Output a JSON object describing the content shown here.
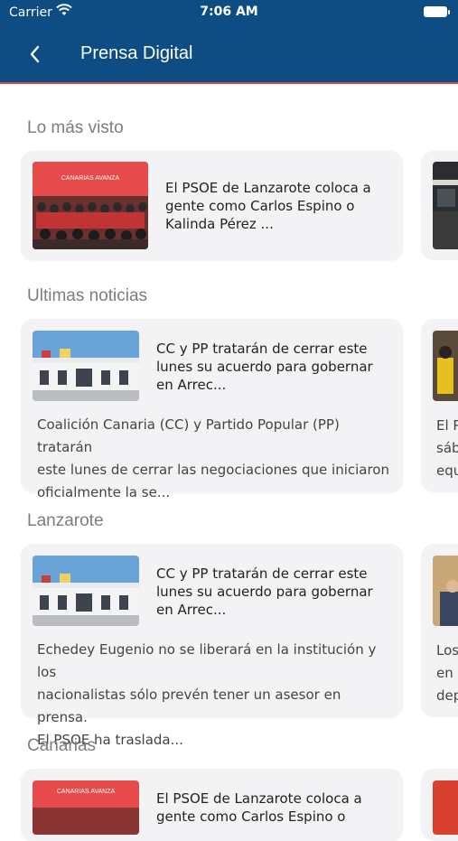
{
  "status_bar": {
    "carrier": "Carrier",
    "time": "7:06 AM"
  },
  "nav": {
    "title": "Prensa Digital"
  },
  "sections": {
    "mas_visto": {
      "title": "Lo más visto",
      "card": {
        "headline": "El PSOE de Lanzarote coloca a\ngente como Carlos Espino o\nKalinda Pérez ...",
        "thumb_text": "CANARIAS AVANZA"
      }
    },
    "ultimas": {
      "title": "Ultimas noticias",
      "card": {
        "headline": "CC y PP tratarán de cerrar este\nlunes su acuerdo para gobernar\nen Arrec...",
        "summary": "Coalición Canaria (CC) y Partido Popular (PP) tratarán\neste lunes de cerrar las negociaciones que iniciaron\noficialmente la se..."
      },
      "peek_text": "El P\nsáb\nequ"
    },
    "lanzarote": {
      "title": "Lanzarote",
      "card": {
        "headline": "CC y PP tratarán de cerrar este\nlunes su acuerdo para gobernar\nen Arrec...",
        "summary": "Echedey Eugenio no se liberará en la institución y los\nnacionalistas sólo prevén tener un asesor en prensa.\nEl PSOE ha traslada..."
      },
      "peek_text": "Los\nen c\ndep"
    },
    "canarias": {
      "title": "Canarias",
      "card": {
        "headline": "El PSOE de Lanzarote coloca a\ngente como Carlos Espino o",
        "thumb_text": "CANARIAS AVANZA"
      }
    }
  }
}
